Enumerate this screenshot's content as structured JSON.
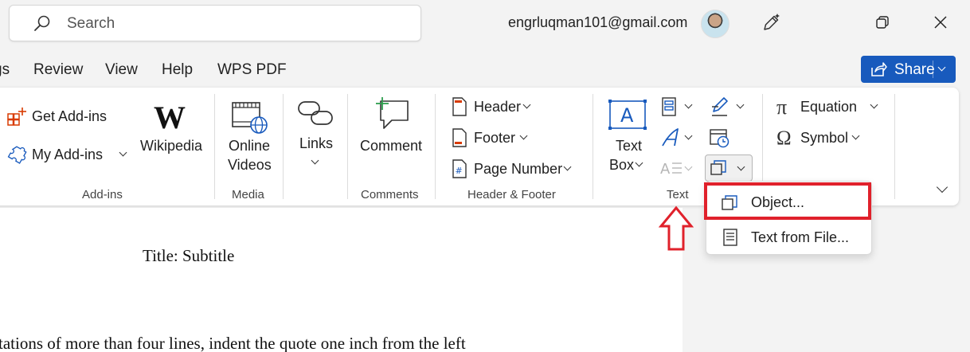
{
  "titlebar": {
    "search_placeholder": "Search",
    "account_email": "engrluqman101@gmail.com"
  },
  "tabs": [
    {
      "label": "gs"
    },
    {
      "label": "Review"
    },
    {
      "label": "View"
    },
    {
      "label": "Help"
    },
    {
      "label": "WPS PDF"
    }
  ],
  "share_button": {
    "label": "Share",
    "color": "#185abd"
  },
  "ribbon": {
    "addins": {
      "get_addins": "Get Add-ins",
      "my_addins": "My Add-ins",
      "wikipedia": "Wikipedia",
      "group": "Add-ins"
    },
    "media": {
      "online_videos_line1": "Online",
      "online_videos_line2": "Videos",
      "group": "Media"
    },
    "links": {
      "label": "Links"
    },
    "comments": {
      "comment": "Comment",
      "group": "Comments"
    },
    "header_footer": {
      "header": "Header",
      "footer": "Footer",
      "page_number": "Page Number",
      "group": "Header & Footer"
    },
    "text": {
      "text_box_line1": "Text",
      "text_box_line2": "Box",
      "group": "Text"
    },
    "symbols": {
      "equation": "Equation",
      "symbol": "Symbol"
    }
  },
  "object_menu": {
    "items": [
      {
        "label": "Object..."
      },
      {
        "label": "Text from File..."
      }
    ],
    "highlight_color": "#e0212b"
  },
  "document": {
    "title_line": "Title: Subtitle",
    "body_line": "tations of more than four lines, indent the quote one inch from the left"
  }
}
